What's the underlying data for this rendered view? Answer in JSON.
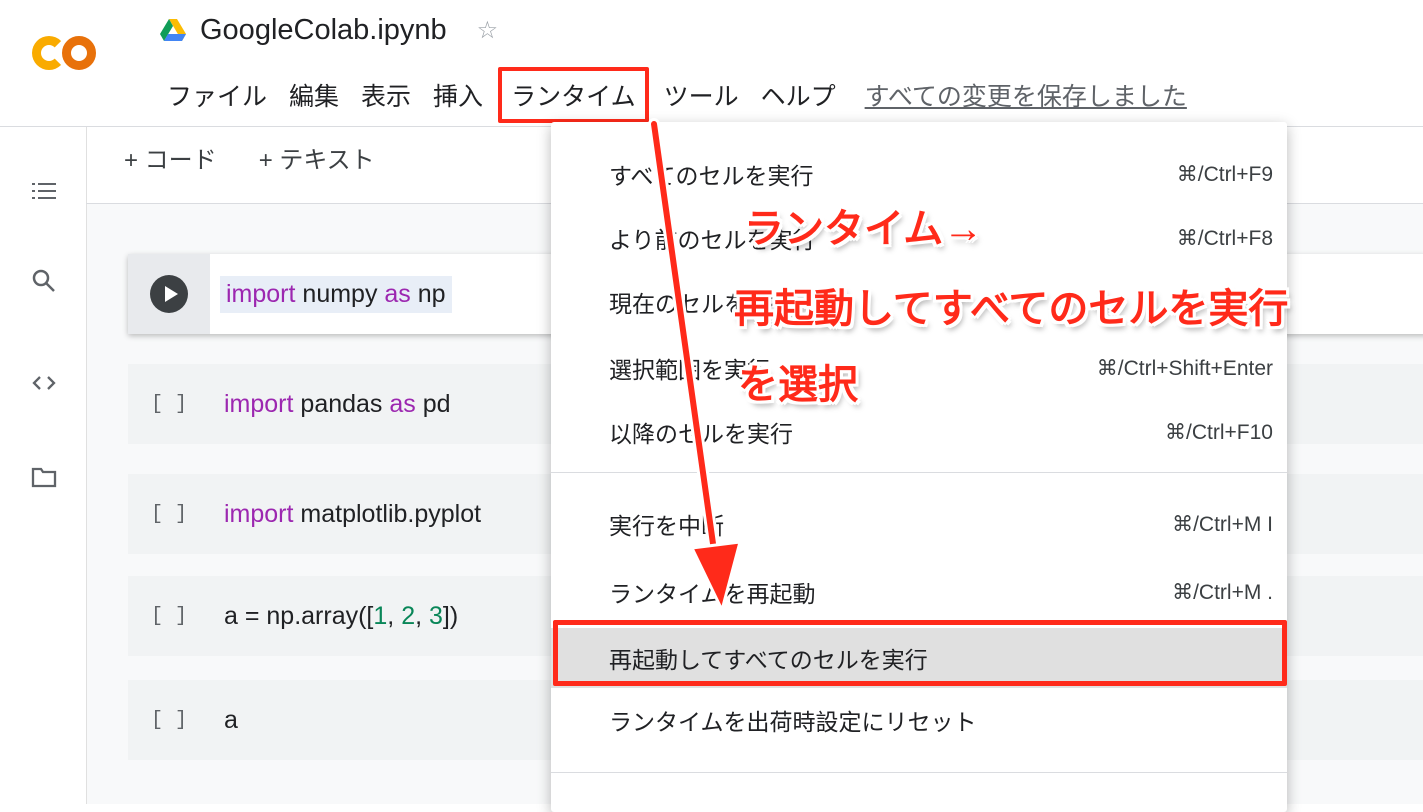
{
  "header": {
    "title": "GoogleColab.ipynb",
    "star_glyph": "☆",
    "menu": [
      {
        "label": "ファイル"
      },
      {
        "label": "編集"
      },
      {
        "label": "表示"
      },
      {
        "label": "挿入"
      },
      {
        "label": "ランタイム"
      },
      {
        "label": "ツール"
      },
      {
        "label": "ヘルプ"
      }
    ],
    "save_status": "すべての変更を保存しました"
  },
  "toolbar": {
    "add_code": "+ コード",
    "add_text": "+ テキスト"
  },
  "cells": [
    {
      "gutter": "",
      "tokens": [
        {
          "t": "import",
          "c": "kw"
        },
        {
          "t": " numpy ",
          "c": ""
        },
        {
          "t": "as",
          "c": "kw"
        },
        {
          "t": " np",
          "c": ""
        }
      ]
    },
    {
      "gutter": "[ ]",
      "tokens": [
        {
          "t": "import",
          "c": "kw"
        },
        {
          "t": " pandas ",
          "c": ""
        },
        {
          "t": "as",
          "c": "kw"
        },
        {
          "t": " pd",
          "c": ""
        }
      ]
    },
    {
      "gutter": "[ ]",
      "tokens": [
        {
          "t": "import",
          "c": "kw"
        },
        {
          "t": " matplotlib.pyplot",
          "c": ""
        }
      ]
    },
    {
      "gutter": "[ ]",
      "tokens": [
        {
          "t": "a = np.array([",
          "c": ""
        },
        {
          "t": "1",
          "c": "num"
        },
        {
          "t": ", ",
          "c": ""
        },
        {
          "t": "2",
          "c": "num"
        },
        {
          "t": ", ",
          "c": ""
        },
        {
          "t": "3",
          "c": "num"
        },
        {
          "t": "])",
          "c": ""
        }
      ]
    },
    {
      "gutter": "[ ]",
      "tokens": [
        {
          "t": "a",
          "c": ""
        }
      ]
    }
  ],
  "runtime_menu": [
    {
      "label": "すべてのセルを実行",
      "shortcut": "⌘/Ctrl+F9"
    },
    {
      "label": "より前のセルを実行",
      "shortcut": "⌘/Ctrl+F8"
    },
    {
      "label": "現在のセルを実行",
      "shortcut": ""
    },
    {
      "label": "選択範囲を実行",
      "shortcut": "⌘/Ctrl+Shift+Enter"
    },
    {
      "label": "以降のセルを実行",
      "shortcut": "⌘/Ctrl+F10"
    },
    {
      "label": "実行を中断",
      "shortcut": "⌘/Ctrl+M I"
    },
    {
      "label": "ランタイムを再起動",
      "shortcut": "⌘/Ctrl+M ."
    },
    {
      "label": "再起動してすべてのセルを実行",
      "shortcut": ""
    },
    {
      "label": "ランタイムを出荷時設定にリセット",
      "shortcut": ""
    }
  ],
  "annotation": {
    "line1": "ランタイム→",
    "line2": "再起動してすべてのセルを実行",
    "line3": "を選択"
  },
  "colors": {
    "highlight": "#ff2a1a",
    "keyword": "#9c27b0",
    "number": "#098658"
  },
  "icons": {
    "rail": [
      "toc-icon",
      "search-icon",
      "code-snippets-icon",
      "folder-icon"
    ]
  }
}
